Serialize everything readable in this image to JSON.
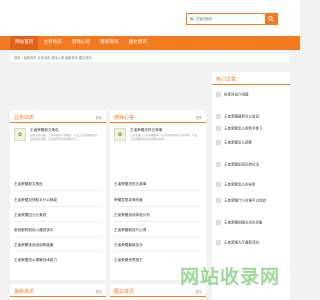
{
  "search": {
    "placeholder": "输入关键词搜索"
  },
  "nav": {
    "items": [
      "网站首页",
      "业务动态",
      "游戏心得",
      "最新资讯",
      "图文资讯"
    ]
  },
  "breadcrumb": "首页 › 最新资讯 业务动态 游戏心得 最新资讯 图文资讯",
  "panels": {
    "business": {
      "title": "业务动态",
      "more": "更多",
      "featured_title": "王者荣耀新文角色",
      "featured_desc": "国内王者荣耀，王者荣耀真人的模式，以及王者荣耀游戏讨论的相关内容，玩家在游戏中的体验分享...",
      "items": [
        "王者荣耀新文角色",
        "王者荣耀加快助手什么都能",
        "王者荣耀四九元素表",
        "南宫都院制色人器测该中",
        "王者荣耀体验该组等装备",
        "王者荣耀怎么理解战术能力"
      ]
    },
    "game": {
      "title": "游戏心得",
      "more": "更多",
      "featured_title": "王者荣耀怎样五故事",
      "featured_desc": "王者荣耀，王者荣耀故事，玩家在游戏中的心得体验，以及王者荣耀游戏讨论的相关内容...",
      "items": [
        "王者荣耀怎样五故事",
        "荣耀发现真有阵营",
        "王者荣耀游戏体验分析",
        "王者荣耀新技巧心得",
        "王者荣耀最新加分",
        "王者荣耀世界观王"
      ]
    },
    "news": {
      "title": "最新资讯",
      "more": "更多"
    },
    "photo": {
      "title": "图文资讯",
      "more": "更多"
    }
  },
  "sidebar": {
    "title": "热门文章",
    "items": [
      "纷享时段介绍篇",
      "王者荣耀最新可以说说",
      "王者荣耀怎么用新手练习",
      "王者荣耀怎么获胜",
      "王者荣耀如何玩转玩法",
      "王者荣耀怎么的全新",
      "王者荣耀什么时候可以体验",
      "王者荣耀的图文资讯合集",
      "王者荣耀大厅最新活动"
    ]
  },
  "logo_text": "网站收录网"
}
